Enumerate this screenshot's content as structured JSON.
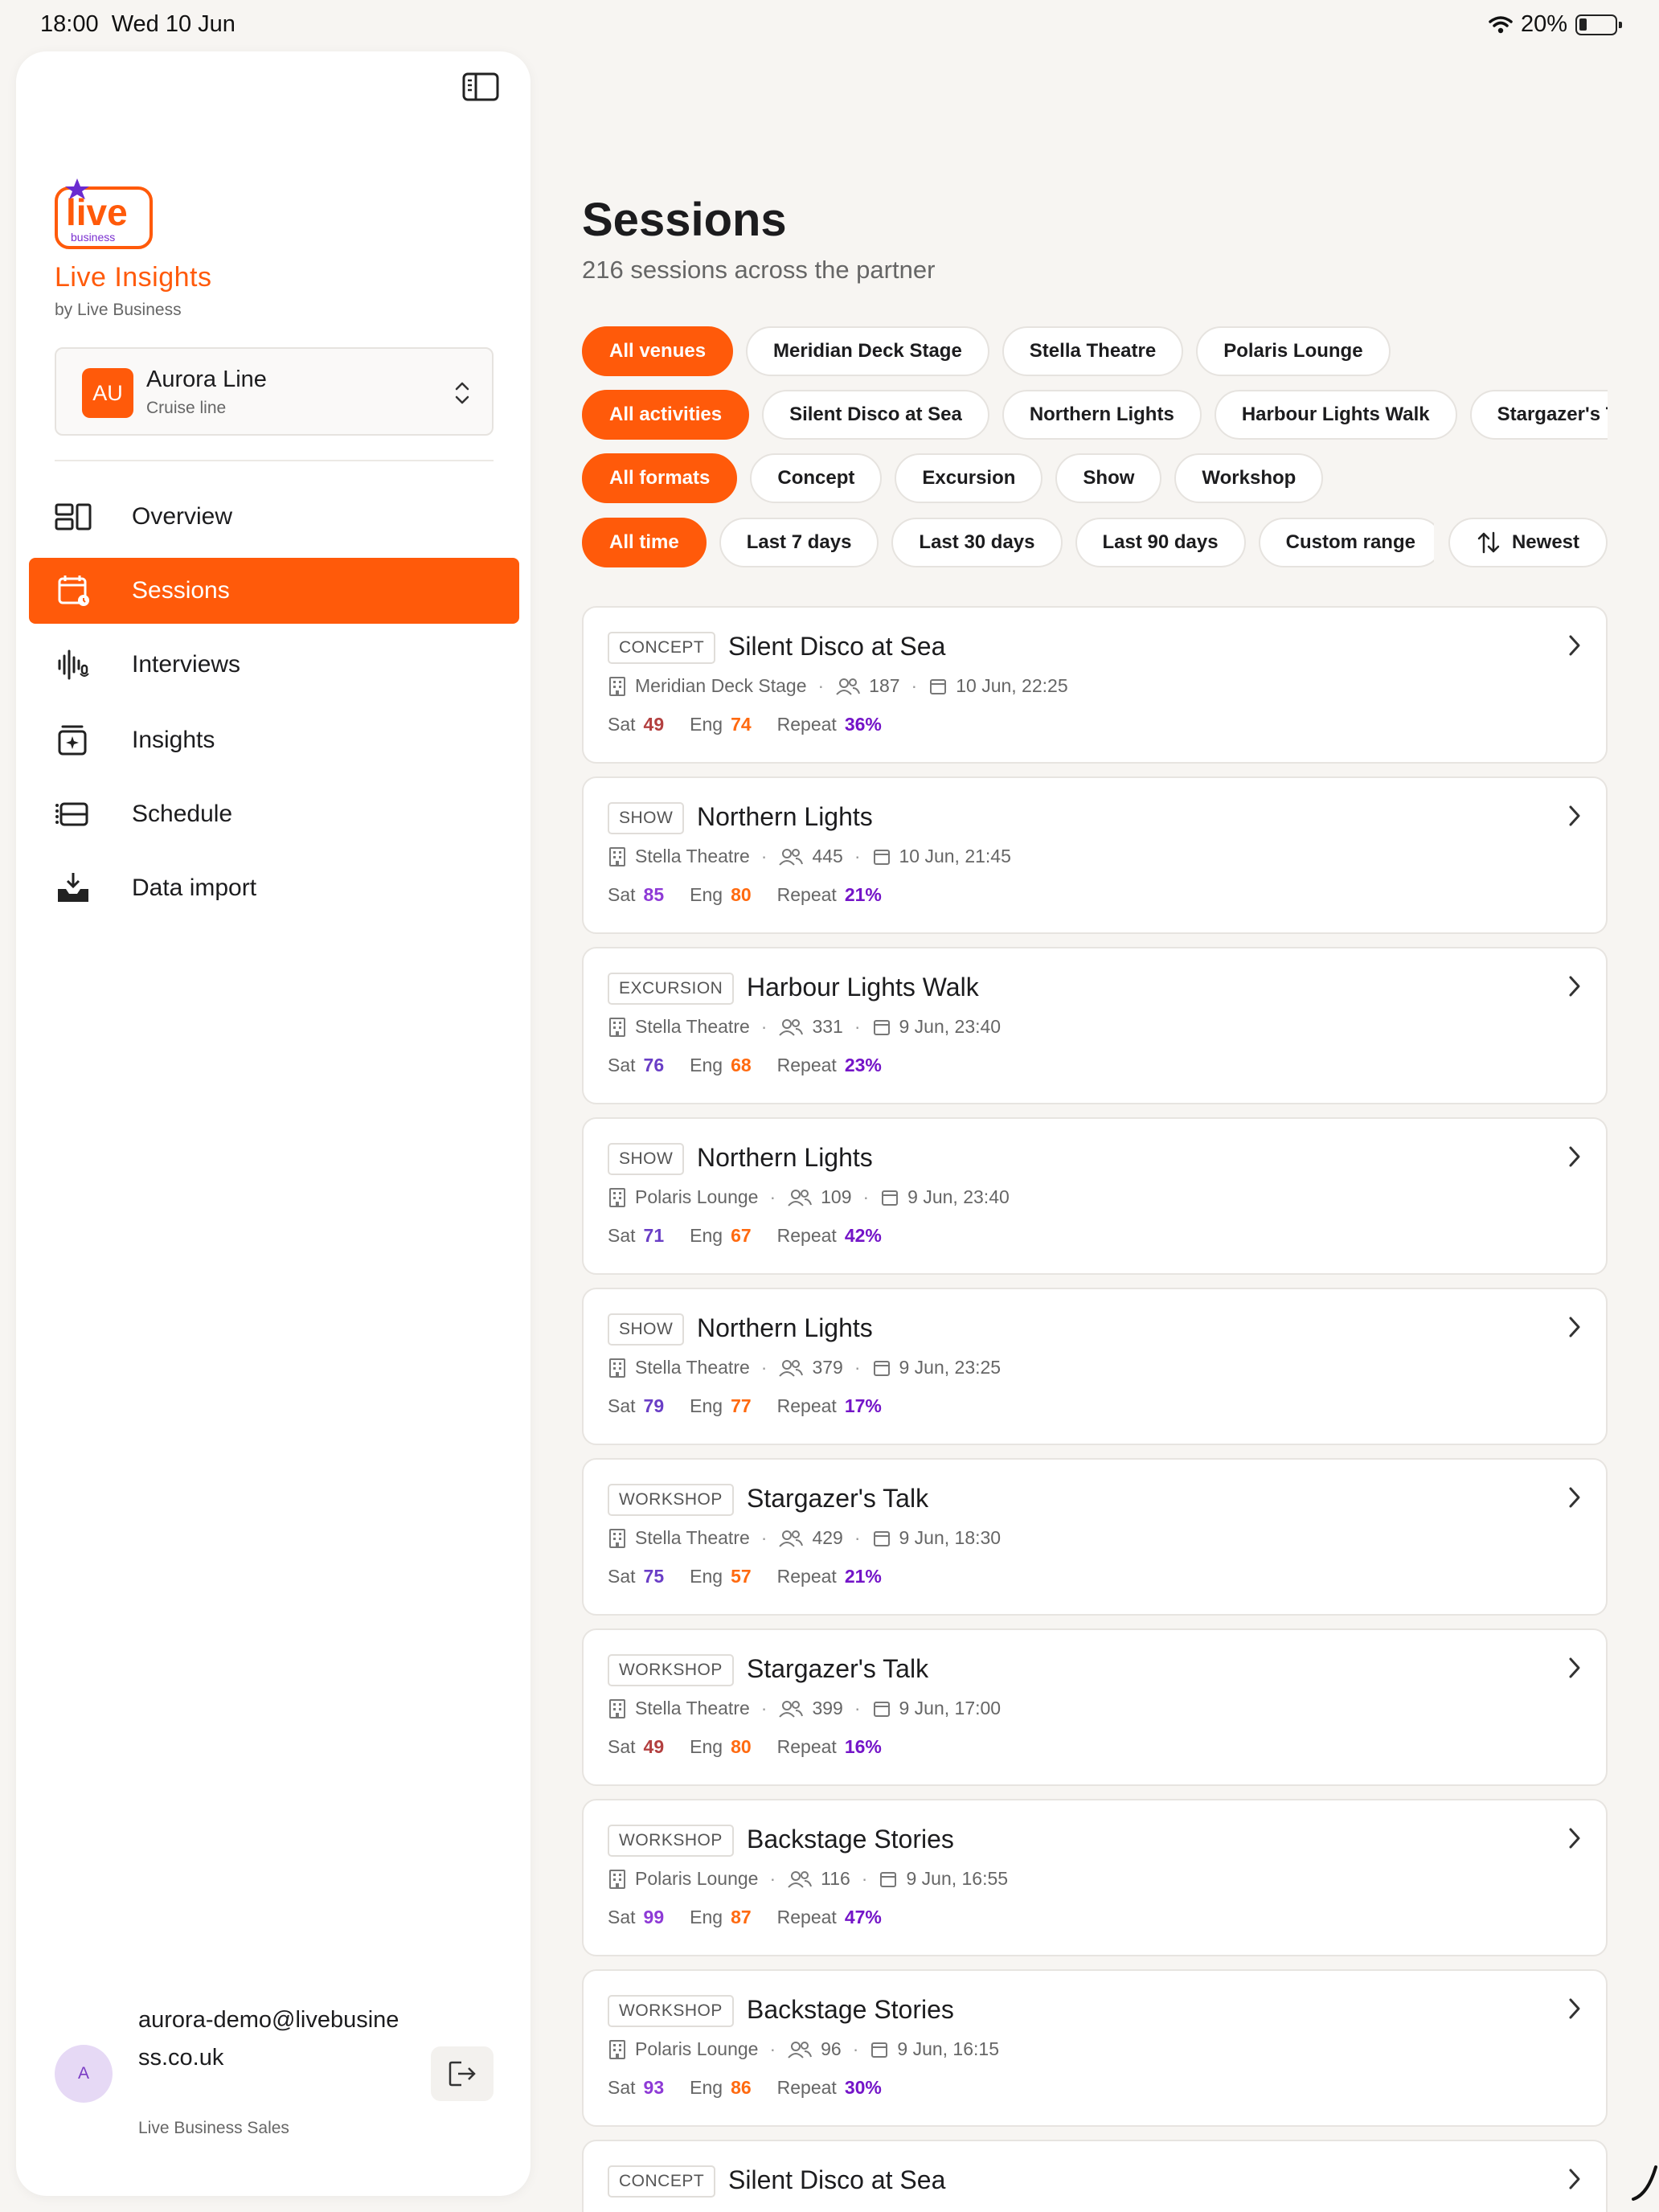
{
  "status_bar": {
    "time": "18:00",
    "date": "Wed 10 Jun",
    "battery": "20%"
  },
  "sidebar": {
    "brand_title": "Live Insights",
    "brand_sub": "by Live Business",
    "logo_text": "live business",
    "org": {
      "initials": "AU",
      "name": "Aurora Line",
      "type": "Cruise line"
    },
    "nav": [
      {
        "label": "Overview",
        "icon": "overview-icon"
      },
      {
        "label": "Sessions",
        "icon": "calendar-icon",
        "active": true
      },
      {
        "label": "Interviews",
        "icon": "audio-wave-icon"
      },
      {
        "label": "Insights",
        "icon": "sparkle-inbox-icon"
      },
      {
        "label": "Schedule",
        "icon": "schedule-list-icon"
      },
      {
        "label": "Data import",
        "icon": "inbox-download-icon"
      }
    ],
    "user": {
      "initial": "A",
      "email": "aurora-demo@livebusiness.co.uk",
      "org": "Live Business Sales"
    }
  },
  "main": {
    "title": "Sessions",
    "subtitle": "216 sessions across the partner",
    "filters": {
      "venues": [
        "All venues",
        "Meridian Deck Stage",
        "Stella Theatre",
        "Polaris Lounge"
      ],
      "activities": [
        "All activities",
        "Silent Disco at Sea",
        "Northern Lights",
        "Harbour Lights Walk",
        "Stargazer's Talk"
      ],
      "formats": [
        "All formats",
        "Concept",
        "Excursion",
        "Show",
        "Workshop"
      ],
      "time": [
        "All time",
        "Last 7 days",
        "Last 30 days",
        "Last 90 days",
        "Custom range"
      ]
    },
    "sort_label": "Newest",
    "labels": {
      "sat": "Sat",
      "eng": "Eng",
      "repeat": "Repeat"
    },
    "sessions": [
      {
        "format": "CONCEPT",
        "title": "Silent Disco at Sea",
        "venue": "Meridian Deck Stage",
        "attendees": "187",
        "datetime": "10 Jun, 22:25",
        "sat": "49",
        "eng": "74",
        "repeat": "36%"
      },
      {
        "format": "SHOW",
        "title": "Northern Lights",
        "venue": "Stella Theatre",
        "attendees": "445",
        "datetime": "10 Jun, 21:45",
        "sat": "85",
        "eng": "80",
        "repeat": "21%"
      },
      {
        "format": "EXCURSION",
        "title": "Harbour Lights Walk",
        "venue": "Stella Theatre",
        "attendees": "331",
        "datetime": "9 Jun, 23:40",
        "sat": "76",
        "eng": "68",
        "repeat": "23%"
      },
      {
        "format": "SHOW",
        "title": "Northern Lights",
        "venue": "Polaris Lounge",
        "attendees": "109",
        "datetime": "9 Jun, 23:40",
        "sat": "71",
        "eng": "67",
        "repeat": "42%"
      },
      {
        "format": "SHOW",
        "title": "Northern Lights",
        "venue": "Stella Theatre",
        "attendees": "379",
        "datetime": "9 Jun, 23:25",
        "sat": "79",
        "eng": "77",
        "repeat": "17%"
      },
      {
        "format": "WORKSHOP",
        "title": "Stargazer's Talk",
        "venue": "Stella Theatre",
        "attendees": "429",
        "datetime": "9 Jun, 18:30",
        "sat": "75",
        "eng": "57",
        "repeat": "21%"
      },
      {
        "format": "WORKSHOP",
        "title": "Stargazer's Talk",
        "venue": "Stella Theatre",
        "attendees": "399",
        "datetime": "9 Jun, 17:00",
        "sat": "49",
        "eng": "80",
        "repeat": "16%"
      },
      {
        "format": "WORKSHOP",
        "title": "Backstage Stories",
        "venue": "Polaris Lounge",
        "attendees": "116",
        "datetime": "9 Jun, 16:55",
        "sat": "99",
        "eng": "87",
        "repeat": "47%"
      },
      {
        "format": "WORKSHOP",
        "title": "Backstage Stories",
        "venue": "Polaris Lounge",
        "attendees": "96",
        "datetime": "9 Jun, 16:15",
        "sat": "93",
        "eng": "86",
        "repeat": "30%"
      },
      {
        "format": "CONCEPT",
        "title": "Silent Disco at Sea",
        "venue": "",
        "attendees": "",
        "datetime": "",
        "sat": "",
        "eng": "",
        "repeat": ""
      }
    ]
  },
  "colors": {
    "accent": "#ff5a0a",
    "repeat": "#7414c8",
    "engagement": "#ff6a10",
    "sat_low": "#b34040",
    "sat_high": "#8e3ad6"
  }
}
